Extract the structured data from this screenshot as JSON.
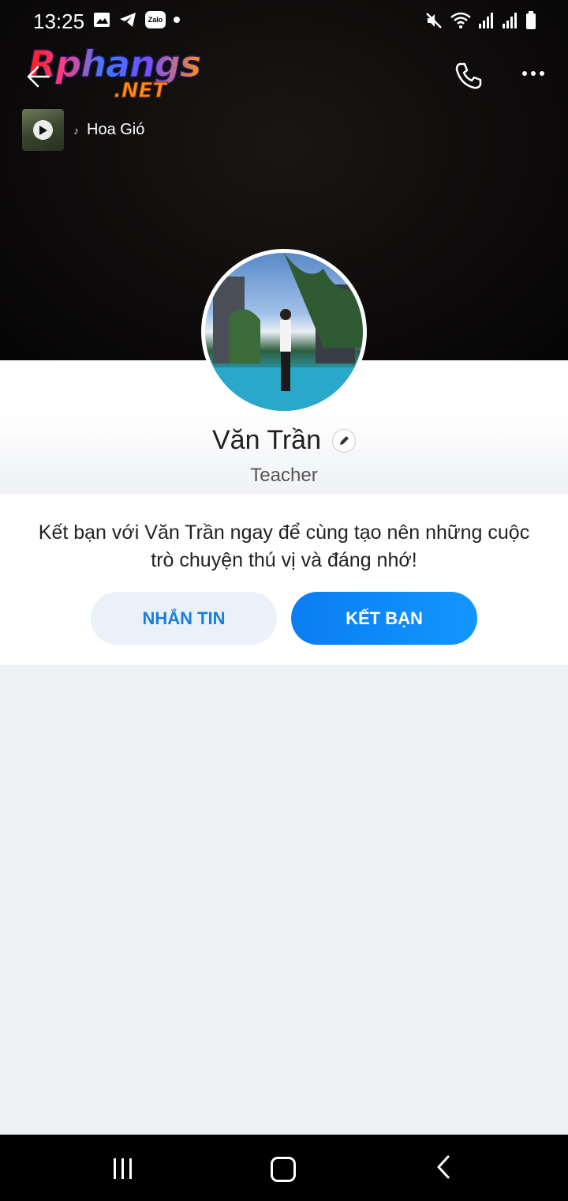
{
  "status_bar": {
    "time": "13:25",
    "left_icons": [
      "image-icon",
      "telegram-icon",
      "zalo-icon",
      "dot-icon"
    ],
    "zalo_label": "Zalo",
    "right_icons": [
      "mute-icon",
      "wifi-icon",
      "signal-icon",
      "signal-icon",
      "battery-icon"
    ]
  },
  "watermark": {
    "line1": "Rphangs",
    "line2": ".NET"
  },
  "header": {
    "back_icon": "back-arrow-icon",
    "call_icon": "phone-icon",
    "more_icon": "more-icon"
  },
  "music": {
    "title": "Hoa Gió"
  },
  "profile": {
    "name": "Văn Trần",
    "subtitle": "Teacher"
  },
  "friend_card": {
    "message": "Kết bạn với Văn Trần ngay để cùng tạo nên những cuộc trò chuyện thú vị và đáng nhớ!",
    "message_button": "NHẮN TIN",
    "add_friend_button": "KẾT BẠN"
  },
  "colors": {
    "accent": "#0b84ff",
    "secondary_button_bg": "#eaf1f8",
    "secondary_button_text": "#1a7fdc"
  }
}
